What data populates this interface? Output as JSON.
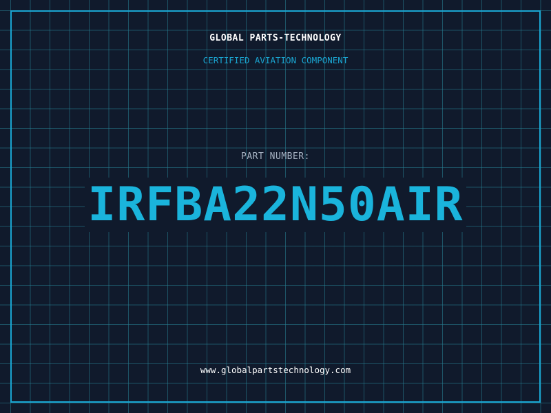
{
  "header": {
    "brand": "GLOBAL PARTS-TECHNOLOGY",
    "tagline": "CERTIFIED AVIATION COMPONENT"
  },
  "part": {
    "label": "PART NUMBER:",
    "number": "IRFBA22N50AIR"
  },
  "footer": {
    "url": "www.globalpartstechnology.com"
  },
  "colors": {
    "background": "#101a2c",
    "accent": "#1aa6d2",
    "grid": "#288296",
    "text": "#ffffff",
    "muted": "#a8b4c4"
  }
}
